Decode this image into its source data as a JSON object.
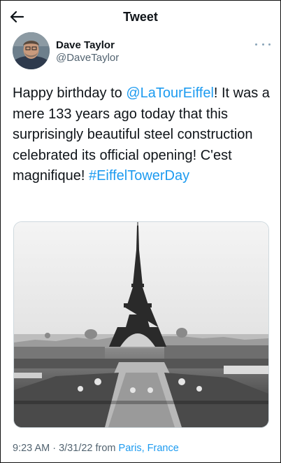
{
  "header": {
    "title": "Tweet",
    "back_icon": "arrow-left-icon"
  },
  "author": {
    "name": "Dave Taylor",
    "handle": "@DaveTaylor",
    "more_icon": "more-horizontal-icon"
  },
  "tweet": {
    "text_1": "Happy birthday to ",
    "mention": "@LaTourEiffel",
    "text_2": "! It was a mere 133 years ago today that this surprisingly beautiful steel construction celebrated its official opening! C'est magnifique! ",
    "hashtag": "#EiffelTowerDay"
  },
  "media": {
    "icon": "photo-eiffel-tower"
  },
  "meta": {
    "time": "9:23 AM",
    "separator": " · ",
    "date": "3/31/22",
    "from_label": " from ",
    "location": "Paris, France"
  },
  "colors": {
    "link": "#1d9bf0",
    "secondary_text": "#536471",
    "text": "#0f1419"
  }
}
